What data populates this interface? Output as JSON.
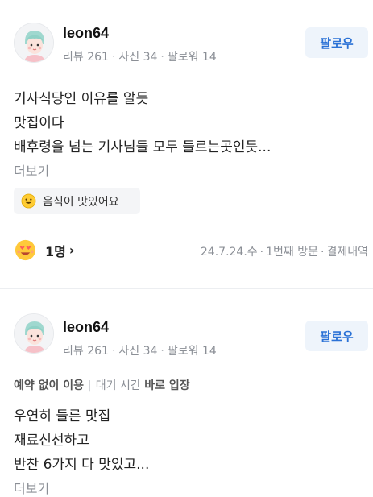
{
  "reviews": [
    {
      "username": "leon64",
      "stats": {
        "reviews": "리뷰 261",
        "photos": "사진 34",
        "followers": "팔로워 14"
      },
      "follow_label": "팔로우",
      "body": [
        "기사식당인 이유를 알듯",
        "맛집이다",
        "배후령을 넘는 기사님들 모두 들르는곳인듯..."
      ],
      "more_label": "더보기",
      "tag": "음식이 맛있어요",
      "reaction_count": "1명",
      "visit": {
        "date": "24.7.24.수",
        "nth": "1번째 방문",
        "payment": "결제내역"
      }
    },
    {
      "username": "leon64",
      "stats": {
        "reviews": "리뷰 261",
        "photos": "사진 34",
        "followers": "팔로워 14"
      },
      "follow_label": "팔로우",
      "wait": {
        "reservation": "예약 없이 이용",
        "wait_label": "대기 시간",
        "wait_value": "바로 입장"
      },
      "body": [
        "우연히 들른 맛집",
        "재료신선하고",
        "반찬 6가지 다 맛있고..."
      ],
      "more_label": "더보기"
    }
  ],
  "colors": {
    "accent": "#2b72d6",
    "follow_bg": "#eef4fb",
    "muted": "#8b8f96"
  },
  "icons": {
    "avatar": "avatar-illustration",
    "tag": "smile-emoji-icon",
    "reaction": "heart-eyes-emoji-icon",
    "chevron": "chevron-right-icon"
  }
}
